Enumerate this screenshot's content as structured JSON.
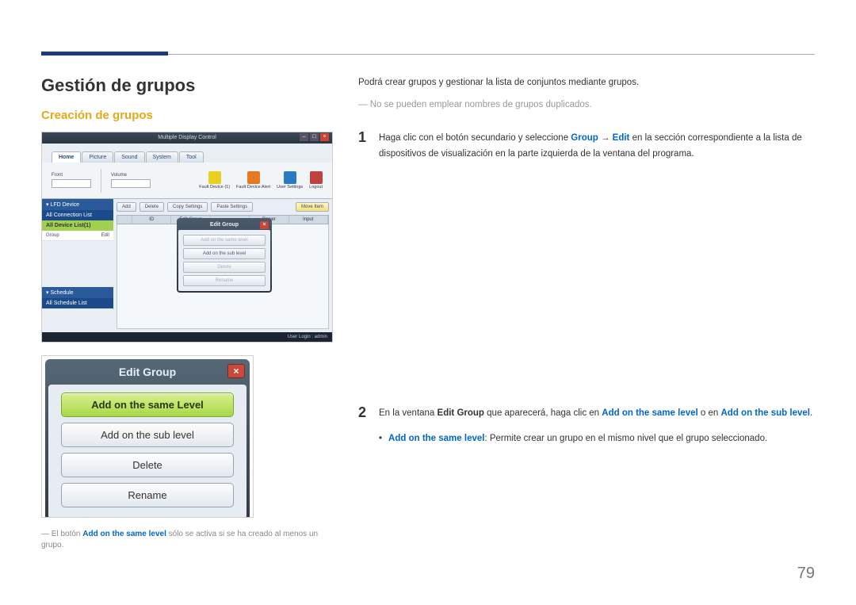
{
  "page_number": "79",
  "left": {
    "h1": "Gestión de grupos",
    "h2": "Creación de grupos",
    "footnote_prefix": "― El botón ",
    "footnote_hl": "Add on the same level",
    "footnote_suffix": " sólo se activa si se ha creado al menos un grupo."
  },
  "right": {
    "intro": "Podrá crear grupos y gestionar la lista de conjuntos mediante grupos.",
    "note": "― No se pueden emplear nombres de grupos duplicados.",
    "step1": {
      "num": "1",
      "t1": "Haga clic con el botón secundario y seleccione ",
      "group": "Group",
      "arrow": " → ",
      "edit": "Edit",
      "t2": " en la sección correspondiente a la lista de dispositivos de visualización en la parte izquierda de la ventana del programa."
    },
    "step2": {
      "num": "2",
      "t1": "En la ventana ",
      "b1": "Edit Group",
      "t2": " que aparecerá, haga clic en ",
      "hl1": "Add on the same level",
      "t3": " o en ",
      "hl2": "Add on the sub level",
      "t4": ".",
      "bullet_lead": "Add on the same level",
      "bullet_text": ": Permite crear un grupo en el mismo nivel que el grupo seleccionado."
    }
  },
  "sshot1": {
    "title": "Multiple Display Control",
    "tabs": [
      "Home",
      "Picture",
      "Sound",
      "System",
      "Tool"
    ],
    "rib_front": "Front",
    "rib_volume": "Volume",
    "rib_icons": [
      {
        "name": "Fault Device (1)",
        "cls": "ic-fault"
      },
      {
        "name": "Fault Device Alert",
        "cls": "ic-fault2"
      },
      {
        "name": "User Settings",
        "cls": "ic-user"
      },
      {
        "name": "Logout",
        "cls": "ic-logout"
      }
    ],
    "side": {
      "hdr1": "▾ LFD Device",
      "hdr2": "All Connection List",
      "sub": "All Device List(1)",
      "row_l": "Group",
      "row_r": "Edit",
      "hdr3": "▾ Schedule",
      "hdr4": "All Schedule List"
    },
    "buttons": [
      "Add",
      "Delete",
      "Copy Settings",
      "Paste Settings"
    ],
    "button_right": "Move Item",
    "cols": [
      "",
      "ID",
      "Edit Group",
      "",
      "Power",
      "Input"
    ],
    "popup": {
      "title": "Edit Group",
      "items": [
        "Add on the same level",
        "Add on the sub level",
        "Delete",
        "Rename"
      ]
    },
    "status": "User Login : admin"
  },
  "sshot2": {
    "title": "Edit Group",
    "buttons": [
      "Add on the same Level",
      "Add on the sub level",
      "Delete",
      "Rename"
    ]
  }
}
